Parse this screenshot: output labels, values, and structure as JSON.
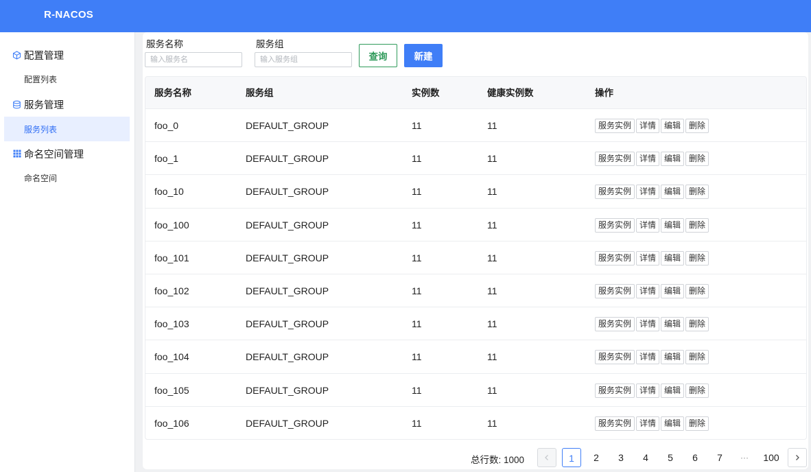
{
  "app": {
    "brand": "R-NACOS"
  },
  "sidebar": {
    "groups": [
      {
        "label": "配置管理",
        "icon": "cube-icon",
        "items": [
          {
            "label": "配置列表"
          }
        ]
      },
      {
        "label": "服务管理",
        "icon": "database-icon",
        "items": [
          {
            "label": "服务列表",
            "active": true
          }
        ]
      },
      {
        "label": "命名空间管理",
        "icon": "grid-icon",
        "items": [
          {
            "label": "命名空间"
          }
        ]
      }
    ]
  },
  "filters": {
    "service_name": {
      "label": "服务名称",
      "placeholder": "输入服务名",
      "value": ""
    },
    "service_group": {
      "label": "服务组",
      "placeholder": "输入服务组",
      "value": ""
    },
    "query_label": "查询",
    "new_label": "新建"
  },
  "table": {
    "columns": [
      "服务名称",
      "服务组",
      "实例数",
      "健康实例数",
      "操作"
    ],
    "actions": [
      "服务实例",
      "详情",
      "编辑",
      "删除"
    ],
    "rows": [
      {
        "name": "foo_0",
        "group": "DEFAULT_GROUP",
        "instances": "11",
        "healthy": "11"
      },
      {
        "name": "foo_1",
        "group": "DEFAULT_GROUP",
        "instances": "11",
        "healthy": "11"
      },
      {
        "name": "foo_10",
        "group": "DEFAULT_GROUP",
        "instances": "11",
        "healthy": "11"
      },
      {
        "name": "foo_100",
        "group": "DEFAULT_GROUP",
        "instances": "11",
        "healthy": "11"
      },
      {
        "name": "foo_101",
        "group": "DEFAULT_GROUP",
        "instances": "11",
        "healthy": "11"
      },
      {
        "name": "foo_102",
        "group": "DEFAULT_GROUP",
        "instances": "11",
        "healthy": "11"
      },
      {
        "name": "foo_103",
        "group": "DEFAULT_GROUP",
        "instances": "11",
        "healthy": "11"
      },
      {
        "name": "foo_104",
        "group": "DEFAULT_GROUP",
        "instances": "11",
        "healthy": "11"
      },
      {
        "name": "foo_105",
        "group": "DEFAULT_GROUP",
        "instances": "11",
        "healthy": "11"
      },
      {
        "name": "foo_106",
        "group": "DEFAULT_GROUP",
        "instances": "11",
        "healthy": "11"
      }
    ]
  },
  "pagination": {
    "total_label": "总行数: 1000",
    "pages": [
      "1",
      "2",
      "3",
      "4",
      "5",
      "6",
      "7"
    ],
    "ellipsis": "···",
    "last_page": "100",
    "current": "1",
    "prev_icon": "chevron-left-icon",
    "next_icon": "chevron-right-icon"
  },
  "colors": {
    "primary": "#3f7ef7",
    "query_green": "#2f9a5a",
    "active_menu_bg": "#e8efff"
  }
}
